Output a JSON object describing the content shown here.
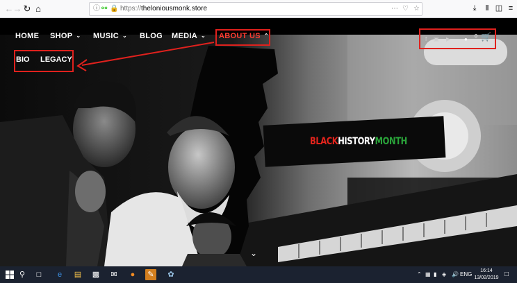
{
  "browser": {
    "url_scheme": "https://",
    "url_host": "theloniousmonk.store"
  },
  "site": {
    "nav": [
      {
        "label": "HOME",
        "has_caret": false
      },
      {
        "label": "SHOP",
        "has_caret": true
      },
      {
        "label": "MUSIC",
        "has_caret": true
      },
      {
        "label": "BLOG",
        "has_caret": false
      },
      {
        "label": "MEDIA",
        "has_caret": true
      },
      {
        "label": "ABOUT US",
        "has_caret": true
      }
    ],
    "about_submenu": [
      "BIO",
      "LEGACY"
    ],
    "cart_count": "0",
    "hero_banner": {
      "word1": "BLACK",
      "word2": "HISTORY",
      "word3": "MONTH"
    }
  },
  "icons": {
    "caret": "⌄",
    "scroll_down": "⌄"
  },
  "colors": {
    "highlight": "#e0211d",
    "bhm_red": "#e3241c",
    "bhm_green": "#2aa43a",
    "taskbar": "#1b2230"
  },
  "taskbar": {
    "lang": "ENG",
    "time": "16:14",
    "date": "13/02/2019"
  }
}
